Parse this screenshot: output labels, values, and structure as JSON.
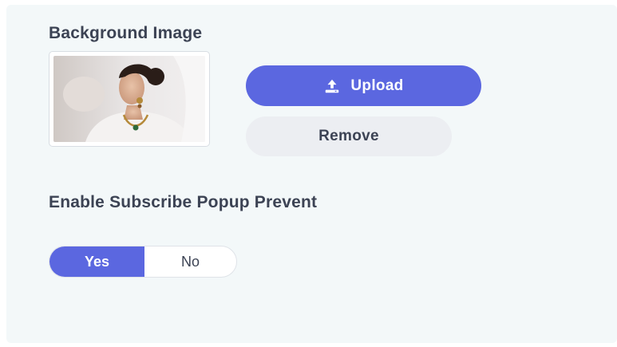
{
  "background_image": {
    "title": "Background Image",
    "upload_label": "Upload",
    "remove_label": "Remove",
    "upload_icon": "upload-icon"
  },
  "popup_prevent": {
    "title": "Enable Subscribe Popup Prevent",
    "options": [
      "Yes",
      "No"
    ],
    "selected": "Yes"
  },
  "colors": {
    "accent": "#5b67e0",
    "panel_bg": "#f3f8f9",
    "secondary_button_bg": "#eceef2",
    "text": "#3c4354"
  }
}
